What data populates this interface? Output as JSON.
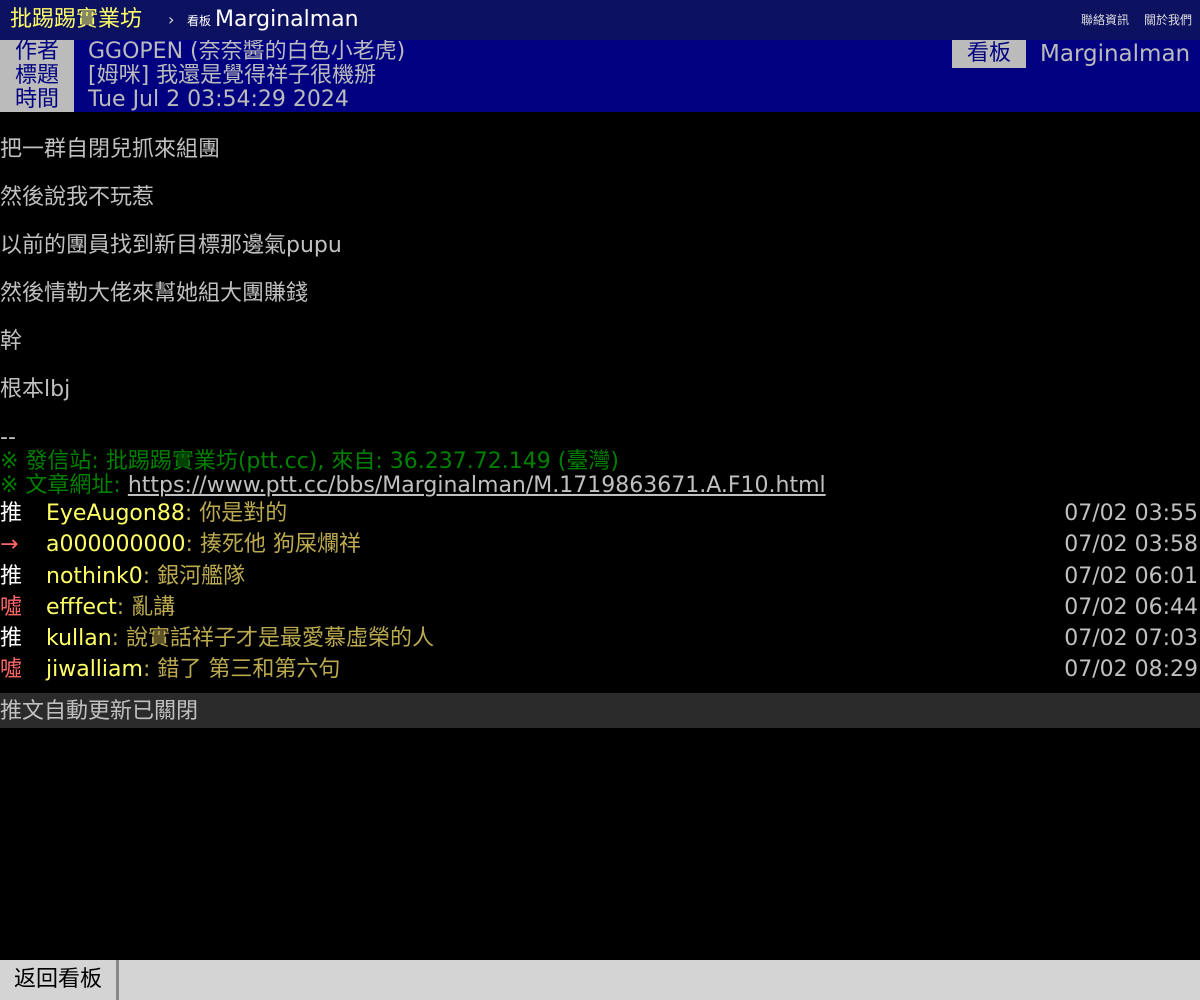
{
  "nav": {
    "site_title": "批踢踢實業坊",
    "separator": "›",
    "board_label": "看板",
    "board_name": "Marginalman",
    "contact": "聯絡資訊",
    "about": "關於我們"
  },
  "meta": {
    "author_tag": "作者",
    "author": "GGOPEN (奈奈醬的白色小老虎)",
    "title_tag": "標題",
    "title": "[姆咪] 我還是覺得祥子很機掰",
    "time_tag": "時間",
    "time": "Tue Jul  2 03:54:29 2024",
    "board_tag": "看板",
    "board": "Marginalman"
  },
  "body": {
    "lines": [
      "把一群自閉兒抓來組團",
      "然後說我不玩惹",
      "以前的團員找到新目標那邊氣pupu",
      "然後情勒大佬來幫她組大團賺錢",
      "幹",
      "根本lbj"
    ],
    "sig_dash": "--",
    "sig_from": "※ 發信站: 批踢踢實業坊(ptt.cc), 來自: 36.237.72.149 (臺灣)",
    "sig_url_label": "※ 文章網址: ",
    "sig_url": "https://www.ptt.cc/bbs/Marginalman/M.1719863671.A.F10.html"
  },
  "pushes": [
    {
      "tag": "推",
      "user": "EyeAugon88",
      "content": ": 你是對的",
      "time": "07/02 03:55",
      "kind": "good"
    },
    {
      "tag": "→",
      "user": "a000000000",
      "content": ": 揍死他   狗屎爛祥",
      "time": "07/02 03:58",
      "kind": "bad"
    },
    {
      "tag": "推",
      "user": "nothink0",
      "content": ": 銀河艦隊",
      "time": "07/02 06:01",
      "kind": "good"
    },
    {
      "tag": "噓",
      "user": "efffect",
      "content": ": 亂講",
      "time": "07/02 06:44",
      "kind": "bad"
    },
    {
      "tag": "推",
      "user": "kullan",
      "content": ": 說實話祥子才是最愛慕虛榮的人",
      "time": "07/02 07:03",
      "kind": "good"
    },
    {
      "tag": "噓",
      "user": "jiwalliam",
      "content": ": 錯了 第三和第六句",
      "time": "07/02 08:29",
      "kind": "bad"
    }
  ],
  "autoupdate": "推文自動更新已關閉",
  "footer": {
    "back": "返回看板"
  },
  "colors": {
    "nav_bg": "#0c1160",
    "meta_bg": "#000080",
    "link_yellow": "#ffff66",
    "signature_green": "#008000",
    "boo_red": "#ff6666"
  }
}
